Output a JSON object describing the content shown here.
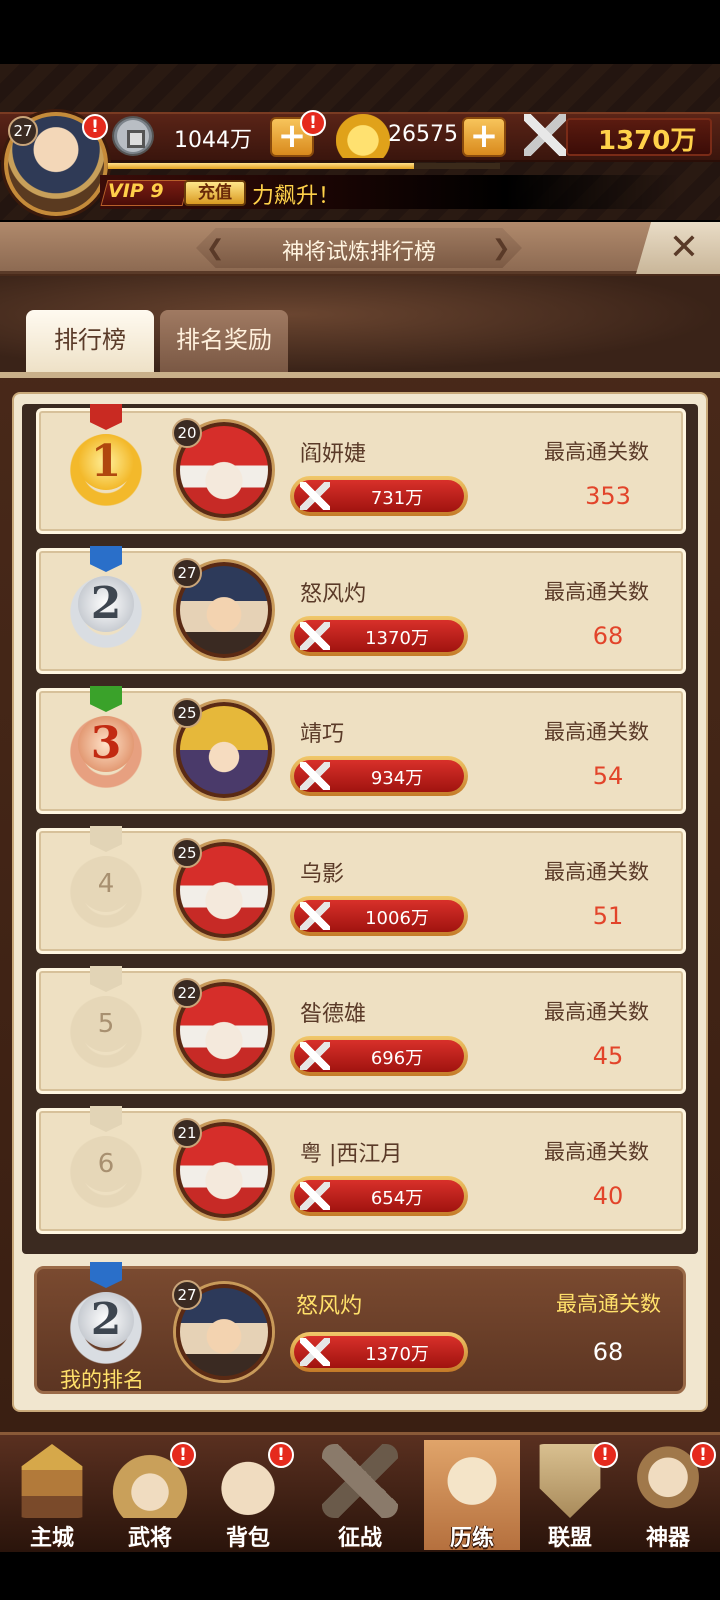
{
  "hud": {
    "player_level": "27",
    "silver": "1044万",
    "gold": "26575",
    "power": "1370万",
    "vip_label": "VIP 9",
    "charge_label": "充值",
    "marquee": "力飙升！",
    "alert_mark": "!",
    "plus_label": "+",
    "exp_progress": 0.78
  },
  "panel": {
    "title": "神将试炼排行榜",
    "close_label": "✕",
    "tabs": [
      {
        "label": "排行榜",
        "active": true
      },
      {
        "label": "排名奖励",
        "active": false
      }
    ]
  },
  "rankings": [
    {
      "rank": "1",
      "level": "20",
      "name": "阎妍婕",
      "power": "731万",
      "stat_label": "最高通关数",
      "stat": "353"
    },
    {
      "rank": "2",
      "level": "27",
      "name": "怒风灼",
      "power": "1370万",
      "stat_label": "最高通关数",
      "stat": "68"
    },
    {
      "rank": "3",
      "level": "25",
      "name": "靖巧",
      "power": "934万",
      "stat_label": "最高通关数",
      "stat": "54"
    },
    {
      "rank": "4",
      "level": "25",
      "name": "乌影",
      "power": "1006万",
      "stat_label": "最高通关数",
      "stat": "51"
    },
    {
      "rank": "5",
      "level": "22",
      "name": "昝德雄",
      "power": "696万",
      "stat_label": "最高通关数",
      "stat": "45"
    },
    {
      "rank": "6",
      "level": "21",
      "name": "粤 |西江月",
      "power": "654万",
      "stat_label": "最高通关数",
      "stat": "40"
    }
  ],
  "my_rank": {
    "rank": "2",
    "label": "我的排名",
    "level": "27",
    "name": "怒风灼",
    "power": "1370万",
    "stat_label": "最高通关数",
    "stat": "68"
  },
  "bottom_nav": [
    {
      "label": "主城"
    },
    {
      "label": "武将"
    },
    {
      "label": "背包"
    },
    {
      "label": "征战"
    },
    {
      "label": "历练"
    },
    {
      "label": "联盟"
    },
    {
      "label": "神器"
    }
  ]
}
